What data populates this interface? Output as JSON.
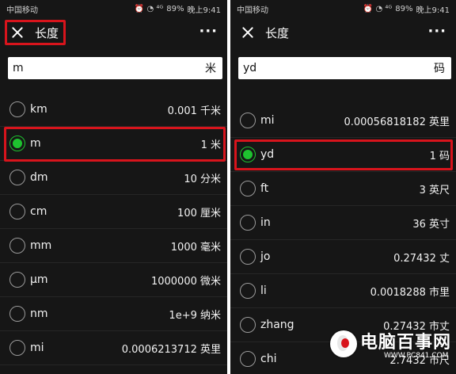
{
  "status": {
    "carrier": "中国移动",
    "signal_glyphs": "⏰ ◔ ⁴ᴳ",
    "battery": "89%",
    "time": "晚上9:41"
  },
  "left": {
    "title": "长度",
    "input": {
      "value": "m",
      "unit": "米"
    },
    "rows": [
      {
        "code": "km",
        "value": "0.001 千米",
        "selected": false
      },
      {
        "code": "m",
        "value": "1 米",
        "selected": true
      },
      {
        "code": "dm",
        "value": "10 分米",
        "selected": false
      },
      {
        "code": "cm",
        "value": "100 厘米",
        "selected": false
      },
      {
        "code": "mm",
        "value": "1000 毫米",
        "selected": false
      },
      {
        "code": "µm",
        "value": "1000000 微米",
        "selected": false
      },
      {
        "code": "nm",
        "value": "1e+9 纳米",
        "selected": false
      },
      {
        "code": "mi",
        "value": "0.0006213712 英里",
        "selected": false
      }
    ]
  },
  "right": {
    "title": "长度",
    "input": {
      "value": "yd",
      "unit": "码"
    },
    "rows": [
      {
        "code": "mi",
        "value": "0.00056818182 英里",
        "selected": false
      },
      {
        "code": "yd",
        "value": "1 码",
        "selected": true
      },
      {
        "code": "ft",
        "value": "3 英尺",
        "selected": false
      },
      {
        "code": "in",
        "value": "36 英寸",
        "selected": false
      },
      {
        "code": "jo",
        "value": "0.27432 丈",
        "selected": false
      },
      {
        "code": "li",
        "value": "0.0018288 市里",
        "selected": false
      },
      {
        "code": "zhang",
        "value": "0.27432 市丈",
        "selected": false
      },
      {
        "code": "chi",
        "value": "2.7432 市尺",
        "selected": false
      }
    ]
  },
  "watermark": {
    "title": "电脑百事网",
    "sub": "WWW.PC841.COM"
  },
  "colors": {
    "accent_green": "#1ec22f",
    "highlight_red": "#d8141c",
    "background": "#161616"
  }
}
